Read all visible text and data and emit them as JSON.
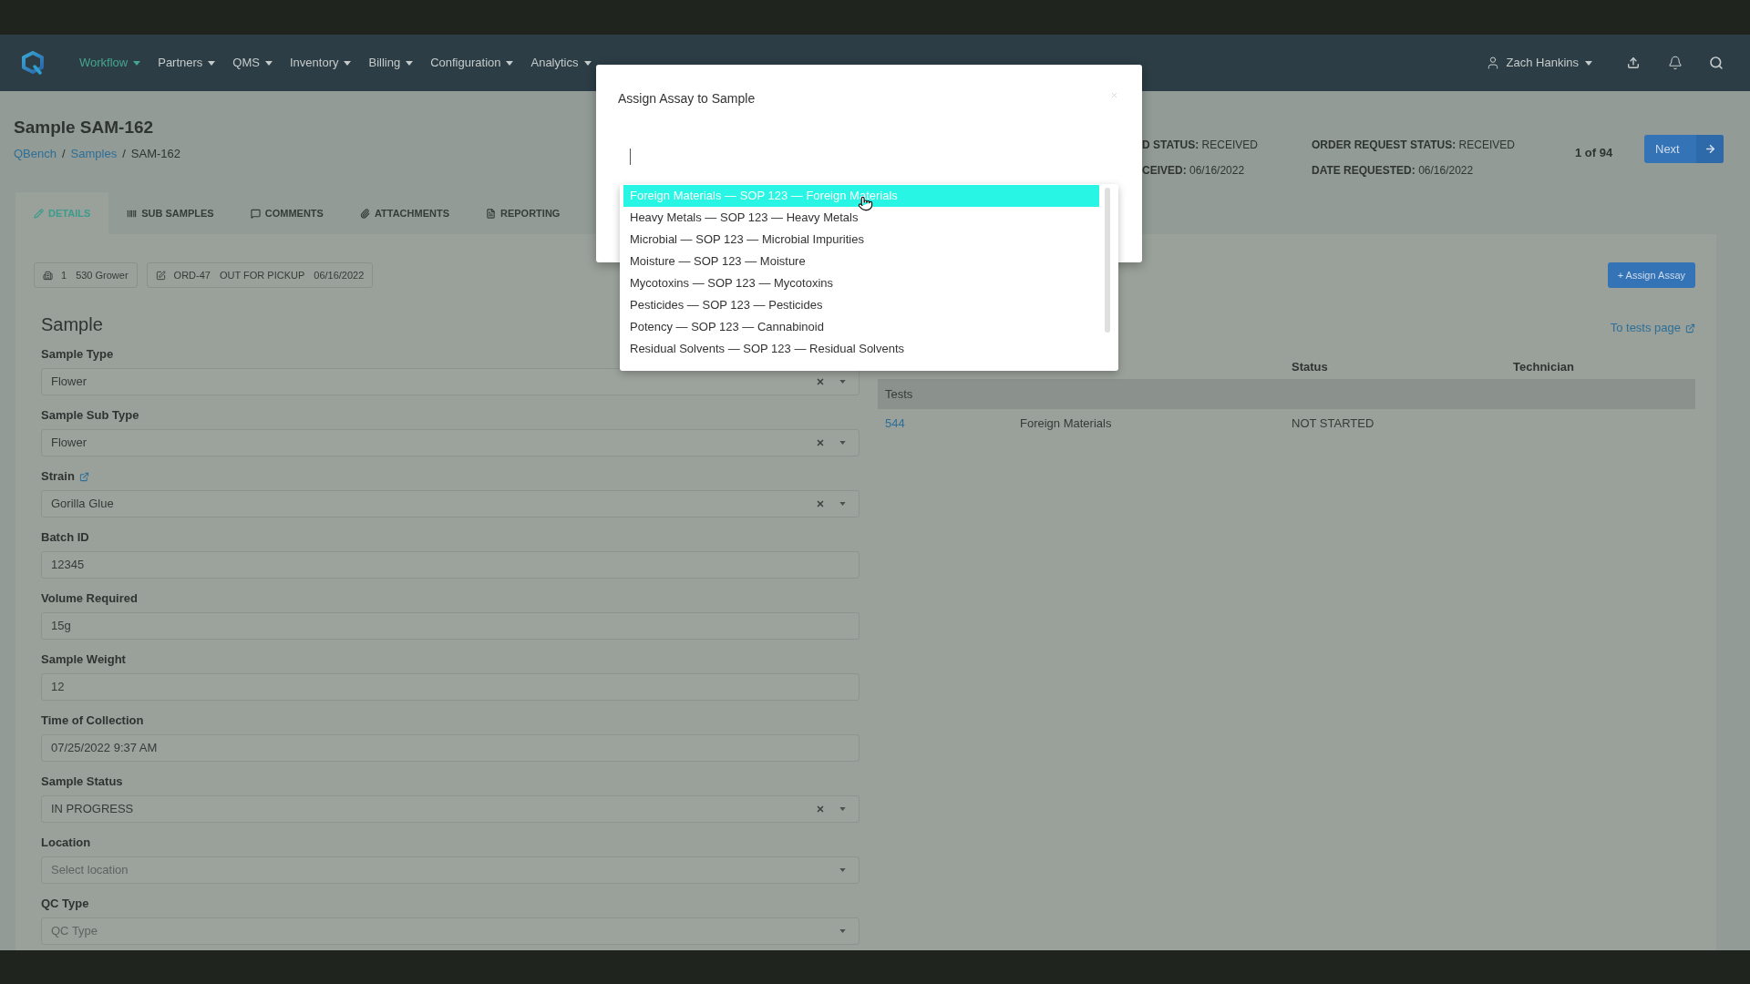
{
  "nav": {
    "items": [
      {
        "label": "Workflow",
        "selected": true
      },
      {
        "label": "Partners",
        "selected": false
      },
      {
        "label": "QMS",
        "selected": false
      },
      {
        "label": "Inventory",
        "selected": false
      },
      {
        "label": "Billing",
        "selected": false
      },
      {
        "label": "Configuration",
        "selected": false
      },
      {
        "label": "Analytics",
        "selected": false
      }
    ],
    "user": "Zach Hankins"
  },
  "header": {
    "title": "Sample SAM-162",
    "breadcrumb": [
      {
        "label": "QBench",
        "link": true,
        "separator": "/"
      },
      {
        "label": "Samples",
        "link": true,
        "separator": "/"
      },
      {
        "label": "SAM-162",
        "link": false
      }
    ],
    "status": [
      [
        "**D STATUS:** RECEIVED",
        "**CEIVED:** 06/16/2022"
      ],
      [
        "**ORDER REQUEST STATUS:** RECEIVED",
        "**DATE REQUESTED:** 06/16/2022"
      ]
    ],
    "pager": {
      "position": "1 of 94",
      "next": "Next"
    }
  },
  "tabs": [
    {
      "label": "DETAILS",
      "selected": true
    },
    {
      "label": "SUB SAMPLES",
      "selected": false
    },
    {
      "label": "COMMENTS",
      "selected": false
    },
    {
      "label": "ATTACHMENTS",
      "selected": false
    },
    {
      "label": "REPORTING",
      "selected": false
    }
  ],
  "chips": [
    {
      "texts": [
        "1",
        "530 Grower"
      ]
    },
    {
      "texts": [
        "ORD-47",
        "OUT FOR PICKUP",
        "06/16/2022"
      ]
    }
  ],
  "assign_button": "+ Assign Assay",
  "sample": {
    "heading": "Sample",
    "fields": [
      {
        "label": "Sample Type",
        "kind": "select",
        "value": "Flower",
        "clearable": true,
        "label_link": false
      },
      {
        "label": "Sample Sub Type",
        "kind": "select",
        "value": "Flower",
        "clearable": true,
        "label_link": false
      },
      {
        "label": "Strain",
        "kind": "select",
        "value": "Gorilla Glue",
        "clearable": true,
        "label_link": true
      },
      {
        "label": "Batch ID",
        "kind": "text",
        "value": "12345",
        "label_link": false
      },
      {
        "label": "Volume Required",
        "kind": "text",
        "value": "15g",
        "label_link": false
      },
      {
        "label": "Sample Weight",
        "kind": "text",
        "value": "12",
        "label_link": false
      },
      {
        "label": "Time of Collection",
        "kind": "text",
        "value": "07/25/2022 9:37 AM",
        "label_link": false
      },
      {
        "label": "Sample Status",
        "kind": "select",
        "value": "IN PROGRESS",
        "clearable": true,
        "label_link": false
      },
      {
        "label": "Location",
        "kind": "select",
        "placeholder": "Select location",
        "clearable": false,
        "label_link": false
      },
      {
        "label": "QC Type",
        "kind": "select",
        "placeholder": "QC Type",
        "clearable": false,
        "label_link": false
      }
    ]
  },
  "assays": {
    "tests_link": "To tests page",
    "columns": [
      "",
      "",
      "Status",
      "Technician"
    ],
    "group": "Tests",
    "rows": [
      {
        "cells": [
          {
            "text": "544",
            "link": true
          },
          {
            "text": "Foreign Materials",
            "link": false
          },
          {
            "text": "NOT STARTED",
            "link": false
          }
        ]
      }
    ]
  },
  "modal": {
    "title": "Assign Assay to Sample",
    "options": [
      {
        "label": "Foreign Materials — SOP 123 — Foreign Materials",
        "selected": true
      },
      {
        "label": "Heavy Metals — SOP 123 — Heavy Metals",
        "selected": false
      },
      {
        "label": "Microbial — SOP 123 — Microbial Impurities",
        "selected": false
      },
      {
        "label": "Moisture — SOP 123 — Moisture",
        "selected": false
      },
      {
        "label": "Mycotoxins — SOP 123 — Mycotoxins",
        "selected": false
      },
      {
        "label": "Pesticides — SOP 123 — Pesticides",
        "selected": false
      },
      {
        "label": "Potency — SOP 123 — Cannabinoid",
        "selected": false
      },
      {
        "label": "Residual Solvents — SOP 123 — Residual Solvents",
        "selected": false
      }
    ]
  }
}
